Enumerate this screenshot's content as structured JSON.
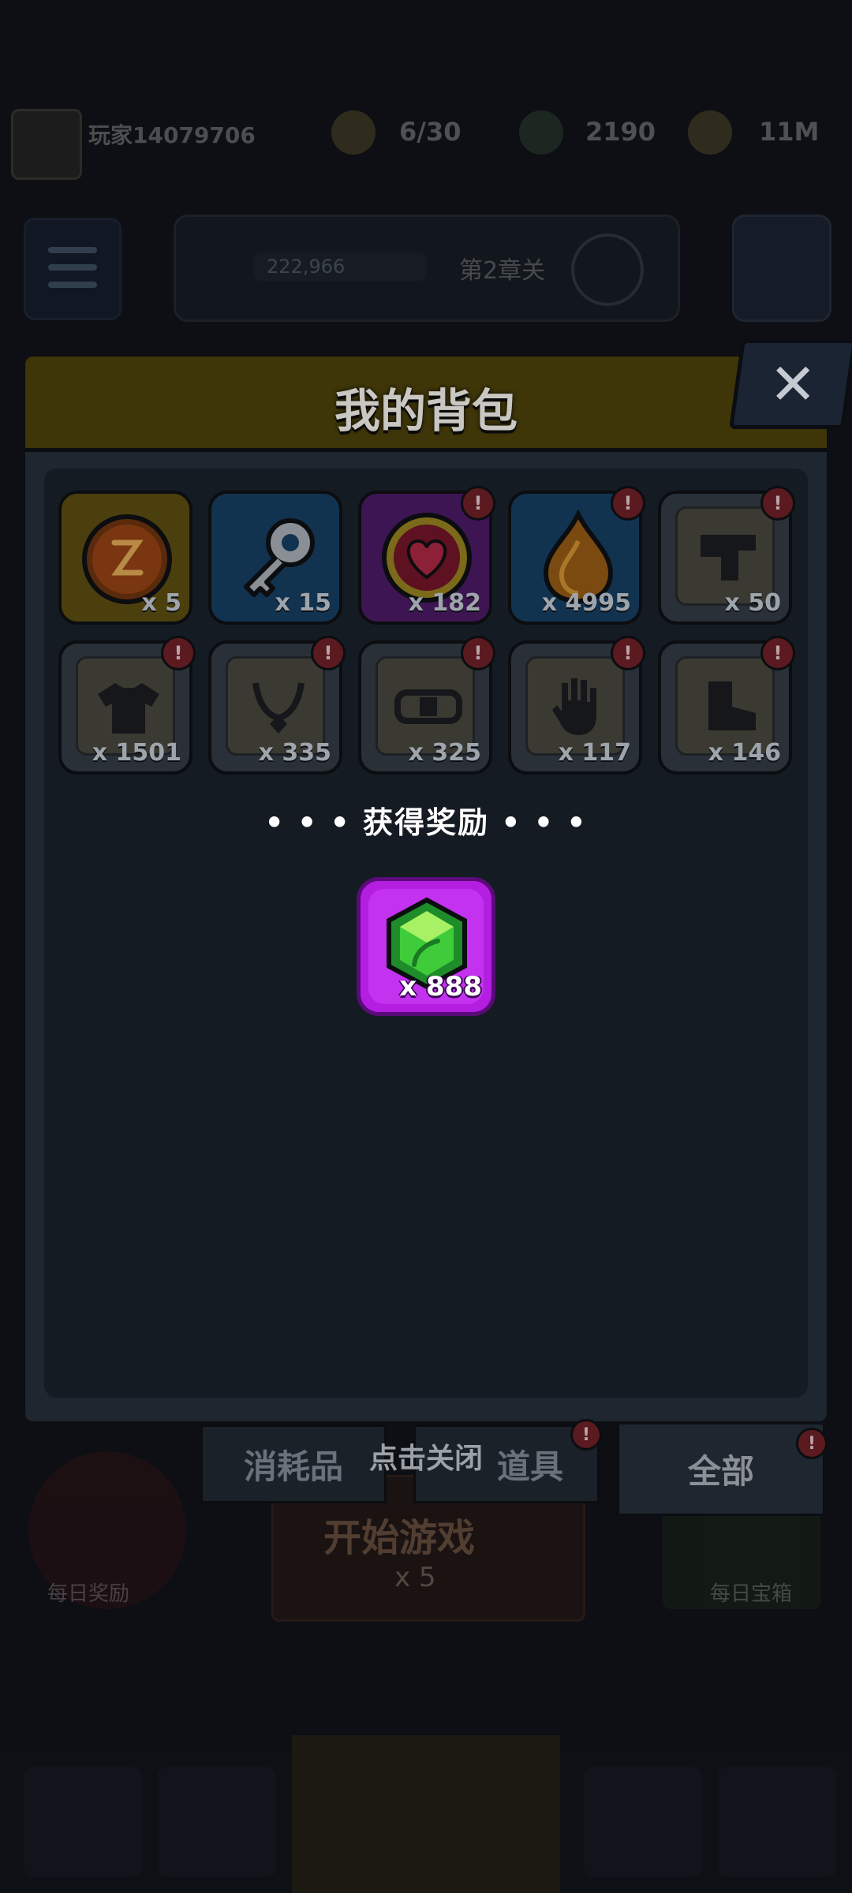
{
  "background": {
    "player_name": "玩家14079706",
    "player_sub": "",
    "resources": [
      {
        "icon": "energy-icon",
        "value": "6/30"
      },
      {
        "icon": "gem-icon",
        "value": "2190"
      },
      {
        "icon": "coin-icon",
        "value": "11M"
      }
    ],
    "banner_value": "222,966",
    "banner_text": "第2章关",
    "bottom_left_label": "每日奖励",
    "bottom_mid_title": "开始游戏",
    "bottom_mid_sub": "x 5",
    "bottom_right_label": "每日宝箱"
  },
  "modal": {
    "title": "我的背包",
    "items": [
      {
        "icon": "rune-orb-icon",
        "qty": "x 5",
        "color": "gold",
        "alert": false
      },
      {
        "icon": "key-icon",
        "qty": "x 15",
        "color": "blue",
        "alert": false
      },
      {
        "icon": "heart-icon",
        "qty": "x 182",
        "color": "purple",
        "alert": true
      },
      {
        "icon": "flame-drop-icon",
        "qty": "x 4995",
        "color": "blue",
        "alert": true
      },
      {
        "icon": "weapon-scroll-icon",
        "qty": "x 50",
        "color": "gray",
        "alert": true
      },
      {
        "icon": "armor-scroll-icon",
        "qty": "x 1501",
        "color": "gray",
        "alert": true
      },
      {
        "icon": "necklace-scroll-icon",
        "qty": "x 335",
        "color": "gray",
        "alert": true
      },
      {
        "icon": "belt-scroll-icon",
        "qty": "x 325",
        "color": "gray",
        "alert": true
      },
      {
        "icon": "glove-scroll-icon",
        "qty": "x 117",
        "color": "gray",
        "alert": true
      },
      {
        "icon": "boots-scroll-icon",
        "qty": "x 146",
        "color": "gray",
        "alert": true
      }
    ],
    "alert_glyph": "!",
    "reward_title": "• • •  获得奖励  • • •",
    "reward": {
      "icon": "green-gem-icon",
      "qty": "x 888"
    },
    "close_hint": "点击关闭",
    "tabs": [
      {
        "label": "消耗品",
        "active": false,
        "alert": false
      },
      {
        "label": "道具",
        "active": false,
        "alert": true
      },
      {
        "label": "全部",
        "active": true,
        "alert": true
      }
    ]
  }
}
